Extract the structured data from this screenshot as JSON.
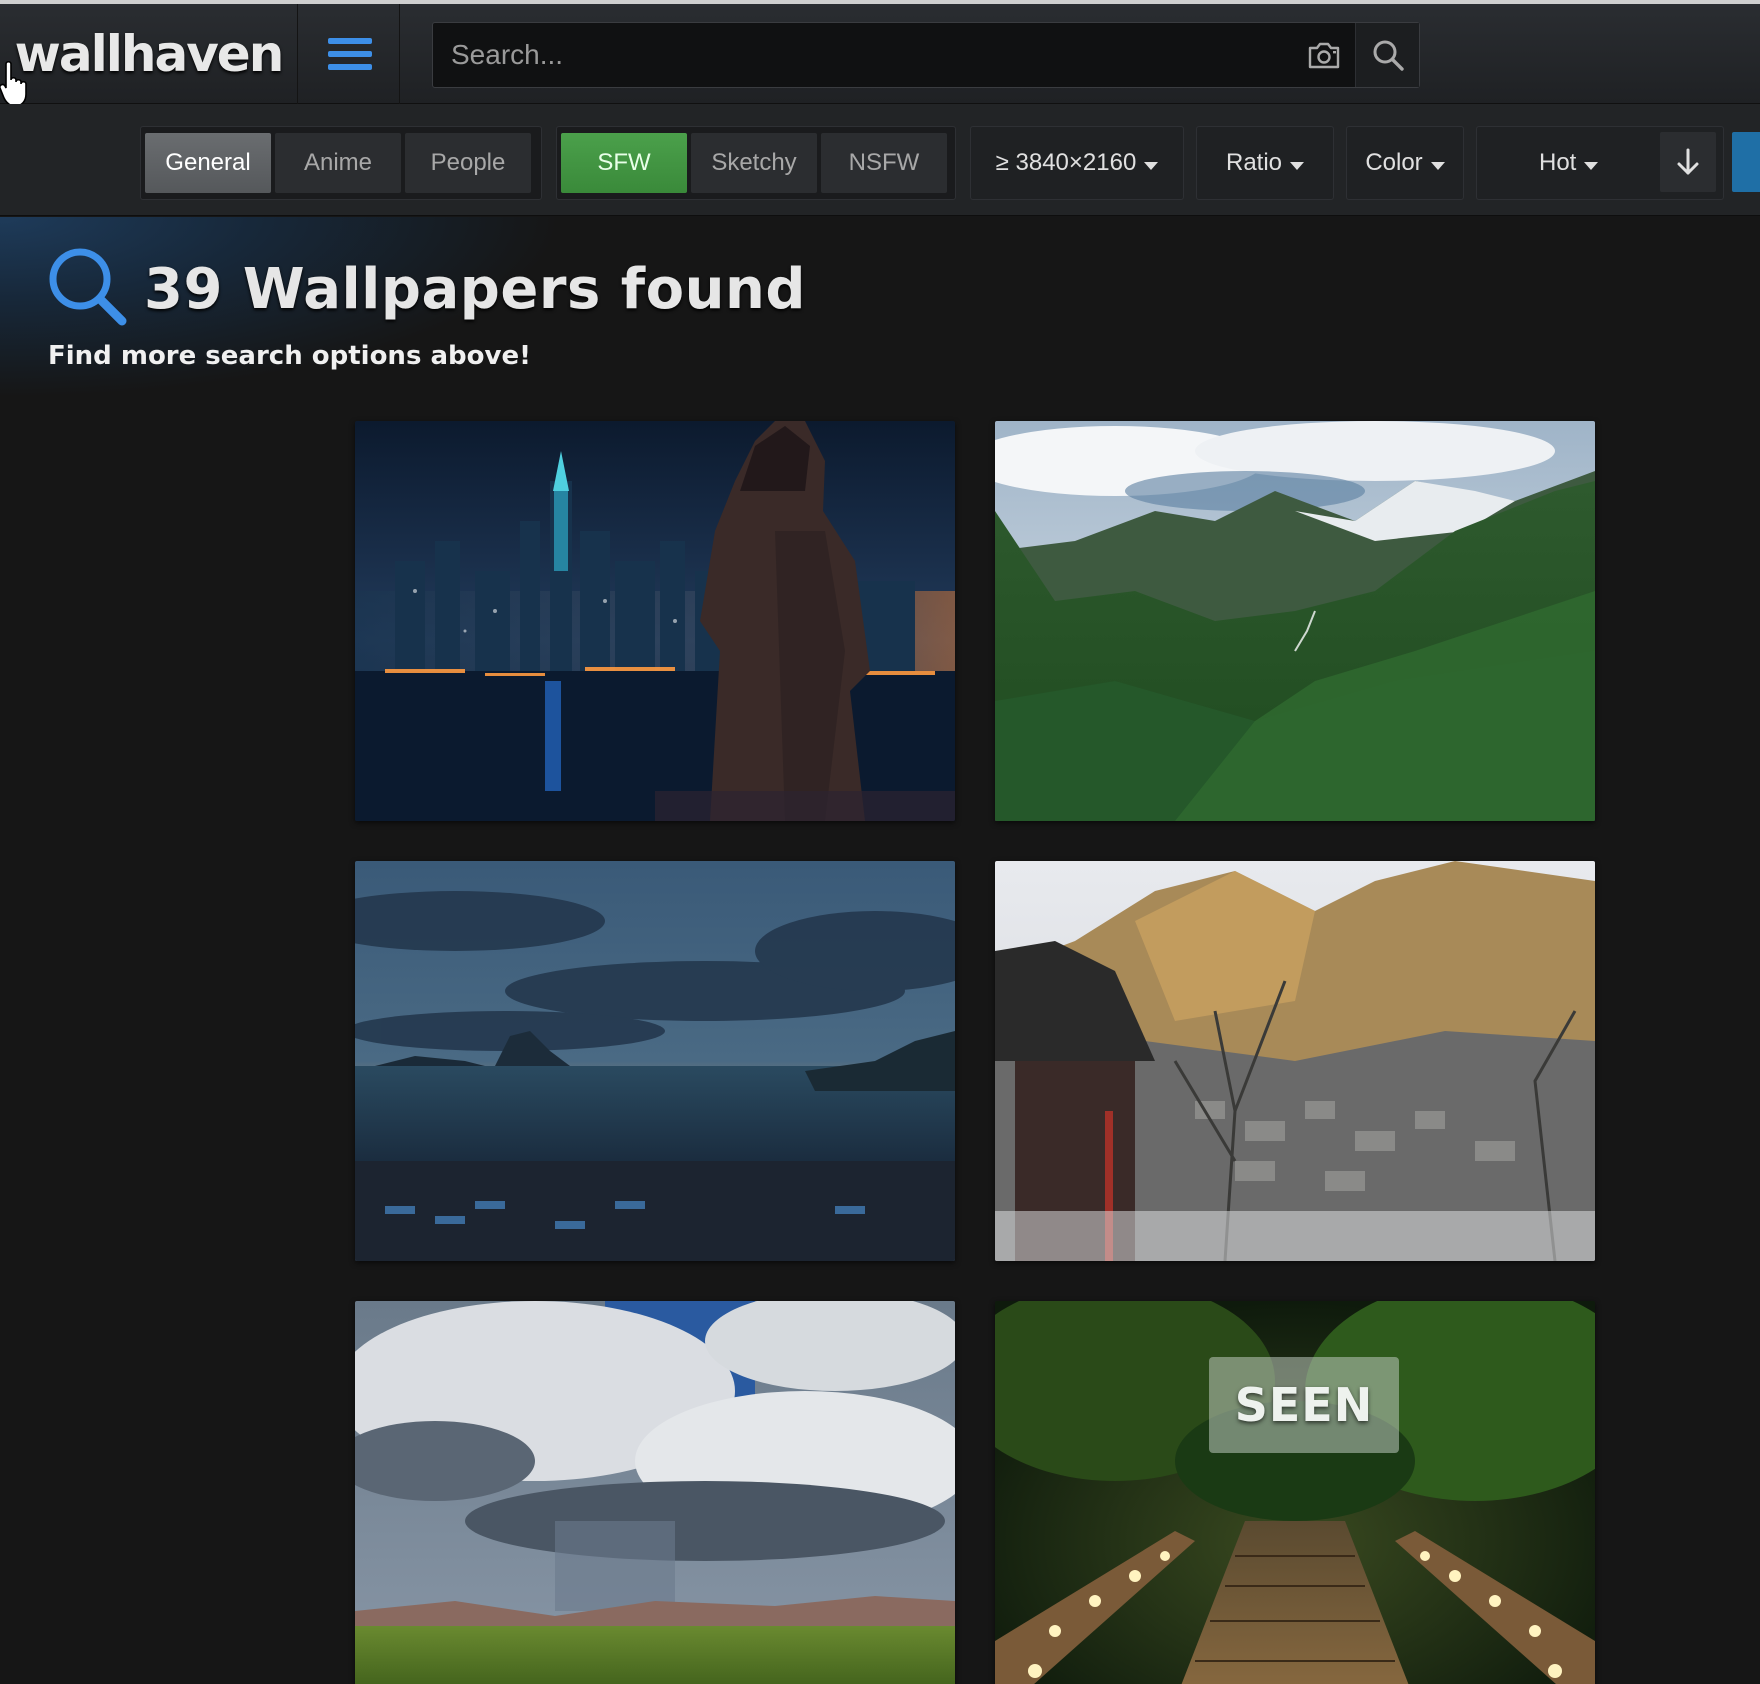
{
  "header": {
    "logo_text": "wallhaven",
    "search": {
      "placeholder": "Search...",
      "value": ""
    }
  },
  "filters": {
    "categories": [
      "General",
      "Anime",
      "People"
    ],
    "purity": [
      "SFW",
      "Sketchy",
      "NSFW"
    ],
    "resolution_label": "≥ 3840×2160",
    "ratio_label": "Ratio",
    "color_label": "Color",
    "sort_label": "Hot",
    "active_category": "General",
    "active_purity": "SFW"
  },
  "results": {
    "title": "39 Wallpapers found",
    "subtitle": "Find more search options above!"
  },
  "thumbnails": [
    {
      "scene": "hooded-figure-city-night"
    },
    {
      "scene": "green-mountain-valley"
    },
    {
      "scene": "sea-sunset-island"
    },
    {
      "scene": "japanese-town-mountain"
    },
    {
      "scene": "storm-clouds-plain"
    },
    {
      "scene": "lit-wooden-stairs-forest",
      "badge": "SEEN"
    }
  ],
  "colors": {
    "accent": "#3d8fe8",
    "sfw_green": "#43963f",
    "background": "#161616"
  },
  "icons": {
    "menu": "menu-icon",
    "camera": "camera-icon",
    "search": "search-icon",
    "sort_order": "arrow-down-icon"
  }
}
